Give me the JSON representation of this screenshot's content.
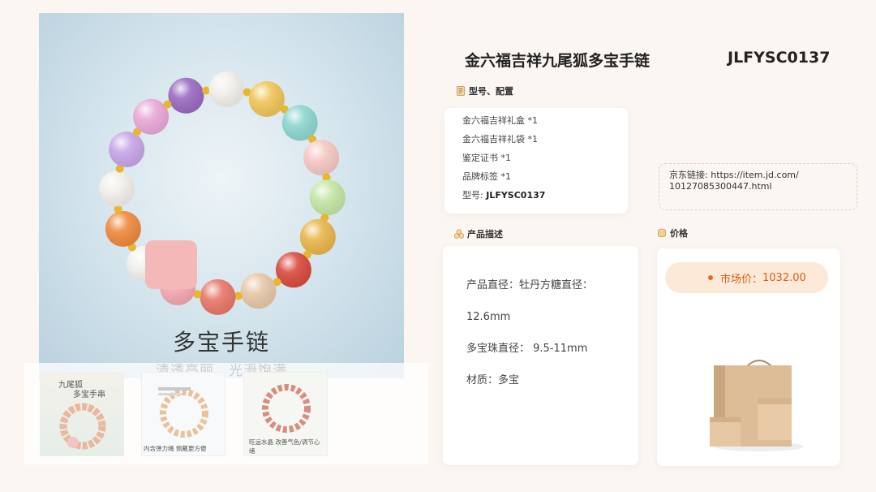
{
  "product": {
    "title": "金六福吉祥九尾狐多宝手链",
    "code": "JLFYSC0137"
  },
  "main_image": {
    "caption_title": "多宝手链",
    "caption_sub": "清透亮丽，光滑饱满"
  },
  "thumbnails": [
    {
      "caption_top": "九尾狐",
      "caption_line2": "多宝手串"
    },
    {
      "caption_bottom": "内含弹力绳 佩戴更方便"
    },
    {
      "caption_bottom": "旺运水晶  改善气色/调节心绪"
    }
  ],
  "config_section": {
    "heading": "型号、配置",
    "items": [
      "金六福吉祥礼盒 *1",
      "金六福吉祥礼袋 *1",
      "鉴定证书 *1",
      "品牌标签 *1"
    ],
    "model_label": "型号:",
    "model_value": "JLFYSC0137"
  },
  "jd_link": {
    "label": "京东链接:",
    "url_part1": "https://item.jd.com/",
    "url_part2": "10127085300447.html"
  },
  "description_section": {
    "heading": "产品描述",
    "lines": [
      "产品直径：牡丹方糖直径：",
      "12.6mm",
      "多宝珠直径： 9.5-11mm",
      "材质：多宝"
    ]
  },
  "price_section": {
    "heading": "价格",
    "market_price_label": "市场价：",
    "market_price_value": "1032.00"
  },
  "icons": {
    "config": "document-icon",
    "description": "coins-icon",
    "price": "coin-stack-icon"
  }
}
